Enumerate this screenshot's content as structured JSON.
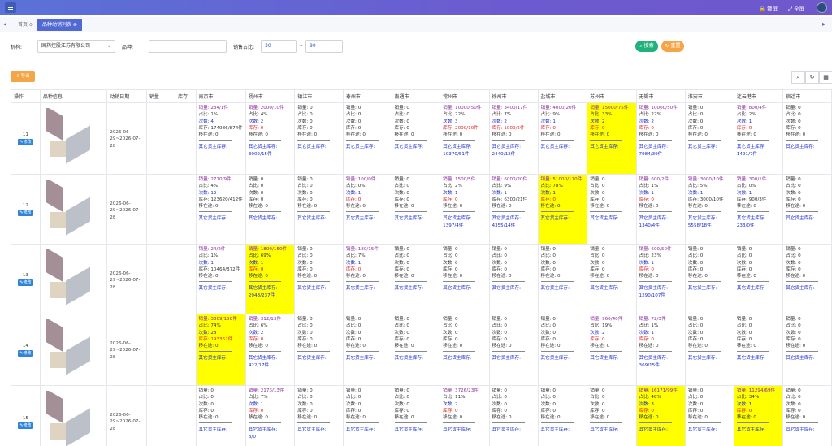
{
  "topbar": {
    "lock_label": "锁屏",
    "fullscreen_label": "全屏"
  },
  "tabs": [
    {
      "label": "首页 ⊙"
    },
    {
      "label": "品种动销列表 ⊗"
    }
  ],
  "filters": {
    "org_label": "机构:",
    "org_value": "国药控股江苏有限公司",
    "variety_label": "品种:",
    "variety_value": "",
    "ratio_label": "销售占比:",
    "ratio_from": "30",
    "ratio_sep": "~",
    "ratio_to": "90",
    "search_label": "搜索",
    "reset_label": "重置"
  },
  "toolbar": {
    "export_label": "导出"
  },
  "columns": [
    "操作",
    "品种信息",
    "动销日期",
    "销量",
    "库存",
    "南京市",
    "扬州市",
    "镇江市",
    "泰州市",
    "南通市",
    "常州市",
    "徐州市",
    "盐城市",
    "苏州市",
    "无锡市",
    "淮安市",
    "连云港市",
    "宿迁市"
  ],
  "labels": {
    "edit": "修改",
    "sales": "销量:",
    "ratio": "占比:",
    "count": "次数:",
    "stock": "库存:",
    "transit": "移在途:",
    "other": "其它货主库存:"
  },
  "rows": [
    {
      "num": "11",
      "period": "2026-06-29~2026-07-28",
      "cities": [
        {
          "s": "234/1件",
          "r": "1%",
          "c": "4",
          "st": "174986/874件",
          "t": "0",
          "o": "",
          "hl": false,
          "stc": "n"
        },
        {
          "s": "2000/10件",
          "r": "4%",
          "c": "2",
          "st": "0",
          "t": "0",
          "o": "3002/15件",
          "hl": false,
          "stc": "r"
        },
        {
          "s": "0",
          "r": "0",
          "c": "0",
          "st": "0",
          "t": "0",
          "o": "",
          "hl": false,
          "stc": "n"
        },
        {
          "s": "0",
          "r": "0",
          "c": "0",
          "st": "0",
          "t": "0",
          "o": "",
          "hl": false,
          "stc": "n"
        },
        {
          "s": "0",
          "r": "0",
          "c": "0",
          "st": "0",
          "t": "0",
          "o": "",
          "hl": false,
          "stc": "n"
        },
        {
          "s": "10000/50件",
          "r": "22%",
          "c": "3",
          "st": "2000/10件",
          "t": "0",
          "o": "10370/51件",
          "hl": false,
          "stc": "r"
        },
        {
          "s": "3400/17件",
          "r": "7%",
          "c": "2",
          "st": "1000/5件",
          "t": "0",
          "o": "2440/12件",
          "hl": false,
          "stc": "r"
        },
        {
          "s": "4000/20件",
          "r": "9%",
          "c": "1",
          "st": "0",
          "t": "0",
          "o": "",
          "hl": false,
          "stc": "r"
        },
        {
          "s": "15000/75件",
          "r": "33%",
          "c": "2",
          "st": "0",
          "t": "0",
          "o": "",
          "hl": true,
          "stc": "r"
        },
        {
          "s": "10000/50件",
          "r": "22%",
          "c": "2",
          "st": "0",
          "t": "0",
          "o": "7984/39件",
          "hl": false,
          "stc": "r"
        },
        {
          "s": "0",
          "r": "0",
          "c": "0",
          "st": "0",
          "t": "0",
          "o": "",
          "hl": false,
          "stc": "n"
        },
        {
          "s": "800/4件",
          "r": "2%",
          "c": "1",
          "st": "0",
          "t": "0",
          "o": "1491/7件",
          "hl": false,
          "stc": "r"
        },
        {
          "s": "0",
          "r": "0",
          "c": "0",
          "st": "0",
          "t": "0",
          "o": "",
          "hl": false,
          "stc": "n"
        }
      ]
    },
    {
      "num": "12",
      "period": "2026-06-29~2026-07-28",
      "cities": [
        {
          "s": "2770/9件",
          "r": "4%",
          "c": "12",
          "st": "123620/412件",
          "t": "0",
          "o": "",
          "hl": false,
          "stc": "n"
        },
        {
          "s": "0",
          "r": "0",
          "c": "0",
          "st": "0",
          "t": "0",
          "o": "",
          "hl": false,
          "stc": "n"
        },
        {
          "s": "0",
          "r": "0",
          "c": "0",
          "st": "0",
          "t": "0",
          "o": "",
          "hl": false,
          "stc": "n"
        },
        {
          "s": "100/0件",
          "r": "0%",
          "c": "1",
          "st": "0",
          "t": "0",
          "o": "",
          "hl": false,
          "stc": "r"
        },
        {
          "s": "0",
          "r": "0",
          "c": "0",
          "st": "0",
          "t": "0",
          "o": "",
          "hl": false,
          "stc": "n"
        },
        {
          "s": "1500/5件",
          "r": "2%",
          "c": "1",
          "st": "0",
          "t": "0",
          "o": "1397/4件",
          "hl": false,
          "stc": "r"
        },
        {
          "s": "6000/20件",
          "r": "9%",
          "c": "1",
          "st": "6300/21件",
          "t": "0",
          "o": "4355/14件",
          "hl": false,
          "stc": "n"
        },
        {
          "s": "51000/170件",
          "r": "78%",
          "c": "1",
          "st": "0",
          "t": "0",
          "o": "",
          "hl": true,
          "stc": "r"
        },
        {
          "s": "0",
          "r": "0",
          "c": "0",
          "st": "0",
          "t": "0",
          "o": "",
          "hl": false,
          "stc": "n"
        },
        {
          "s": "600/2件",
          "r": "1%",
          "c": "1",
          "st": "0",
          "t": "0",
          "o": "1340/4件",
          "hl": false,
          "stc": "r"
        },
        {
          "s": "3000/10件",
          "r": "5%",
          "c": "1",
          "st": "3000/10件",
          "t": "0",
          "o": "5558/18件",
          "hl": false,
          "stc": "n"
        },
        {
          "s": "300/1件",
          "r": "0%",
          "c": "1",
          "st": "900/3件",
          "t": "0",
          "o": "233/0件",
          "hl": false,
          "stc": "n"
        },
        {
          "s": "0",
          "r": "0",
          "c": "0",
          "st": "0",
          "t": "0",
          "o": "",
          "hl": false,
          "stc": "n"
        }
      ]
    },
    {
      "num": "13",
      "period": "2026-06-29~2026-07-28",
      "cities": [
        {
          "s": "24/2件",
          "r": "1%",
          "c": "1",
          "st": "10464/872件",
          "t": "0",
          "o": "",
          "hl": false,
          "stc": "n"
        },
        {
          "s": "1800/150件",
          "r": "69%",
          "c": "1",
          "st": "0",
          "t": "0",
          "o": "2948/237件",
          "hl": true,
          "stc": "r"
        },
        {
          "s": "0",
          "r": "0",
          "c": "0",
          "st": "0",
          "t": "0",
          "o": "",
          "hl": false,
          "stc": "n"
        },
        {
          "s": "180/15件",
          "r": "7%",
          "c": "1",
          "st": "0",
          "t": "0",
          "o": "",
          "hl": false,
          "stc": "r"
        },
        {
          "s": "0",
          "r": "0",
          "c": "0",
          "st": "0",
          "t": "0",
          "o": "",
          "hl": false,
          "stc": "n"
        },
        {
          "s": "0",
          "r": "0",
          "c": "0",
          "st": "0",
          "t": "0",
          "o": "",
          "hl": false,
          "stc": "n"
        },
        {
          "s": "0",
          "r": "0",
          "c": "0",
          "st": "0",
          "t": "0",
          "o": "",
          "hl": false,
          "stc": "n"
        },
        {
          "s": "0",
          "r": "0",
          "c": "0",
          "st": "0",
          "t": "0",
          "o": "",
          "hl": false,
          "stc": "n"
        },
        {
          "s": "0",
          "r": "0",
          "c": "0",
          "st": "0",
          "t": "0",
          "o": "",
          "hl": false,
          "stc": "n"
        },
        {
          "s": "600/50件",
          "r": "23%",
          "c": "1",
          "st": "0",
          "t": "0",
          "o": "1290/107件",
          "hl": false,
          "stc": "r"
        },
        {
          "s": "0",
          "r": "0",
          "c": "0",
          "st": "0",
          "t": "0",
          "o": "",
          "hl": false,
          "stc": "n"
        },
        {
          "s": "0",
          "r": "0",
          "c": "0",
          "st": "0",
          "t": "0",
          "o": "",
          "hl": false,
          "stc": "n"
        },
        {
          "s": "0",
          "r": "0",
          "c": "0",
          "st": "0",
          "t": "0",
          "o": "",
          "hl": false,
          "stc": "n"
        }
      ]
    },
    {
      "num": "14",
      "period": "2026-06-29~2026-07-28",
      "cities": [
        {
          "s": "3809/158件",
          "r": "74%",
          "c": "28",
          "st": "193362件",
          "t": "0",
          "o": "",
          "hl": true,
          "stc": "r"
        },
        {
          "s": "312/13件",
          "r": "6%",
          "c": "2",
          "st": "0",
          "t": "0",
          "o": "422/17件",
          "hl": false,
          "stc": "r"
        },
        {
          "s": "0",
          "r": "0",
          "c": "0",
          "st": "0",
          "t": "0",
          "o": "",
          "hl": false,
          "stc": "n"
        },
        {
          "s": "0",
          "r": "0",
          "c": "0",
          "st": "0",
          "t": "0",
          "o": "",
          "hl": false,
          "stc": "n"
        },
        {
          "s": "0",
          "r": "0",
          "c": "0",
          "st": "0",
          "t": "0",
          "o": "",
          "hl": false,
          "stc": "n"
        },
        {
          "s": "0",
          "r": "0",
          "c": "0",
          "st": "0",
          "t": "0",
          "o": "",
          "hl": false,
          "stc": "n"
        },
        {
          "s": "0",
          "r": "0",
          "c": "0",
          "st": "0",
          "t": "0",
          "o": "",
          "hl": false,
          "stc": "n"
        },
        {
          "s": "0",
          "r": "0",
          "c": "0",
          "st": "0",
          "t": "0",
          "o": "",
          "hl": false,
          "stc": "n"
        },
        {
          "s": "960/40件",
          "r": "19%",
          "c": "2",
          "st": "0",
          "t": "0",
          "o": "",
          "hl": false,
          "stc": "r"
        },
        {
          "s": "72/3件",
          "r": "1%",
          "c": "1",
          "st": "0",
          "t": "0",
          "o": "369/15件",
          "hl": false,
          "stc": "r"
        },
        {
          "s": "0",
          "r": "0",
          "c": "0",
          "st": "0",
          "t": "0",
          "o": "",
          "hl": false,
          "stc": "n"
        },
        {
          "s": "0",
          "r": "0",
          "c": "0",
          "st": "0",
          "t": "0",
          "o": "",
          "hl": false,
          "stc": "n"
        },
        {
          "s": "0",
          "r": "0",
          "c": "0",
          "st": "0",
          "t": "0",
          "o": "",
          "hl": false,
          "stc": "n"
        }
      ]
    },
    {
      "num": "15",
      "period": "2026-06-29~2026-07-28",
      "cities": [
        {
          "s": "0",
          "r": "0",
          "c": "0",
          "st": "0",
          "t": "0",
          "o": "",
          "hl": false,
          "stc": "n"
        },
        {
          "s": "2173/13件",
          "r": "7%",
          "c": "1",
          "st": "0",
          "t": "0",
          "o": "3/0",
          "hl": false,
          "stc": "r"
        },
        {
          "s": "0",
          "r": "0",
          "c": "0",
          "st": "0",
          "t": "0",
          "o": "",
          "hl": false,
          "stc": "n"
        },
        {
          "s": "0",
          "r": "0",
          "c": "0",
          "st": "0",
          "t": "0",
          "o": "",
          "hl": false,
          "stc": "n"
        },
        {
          "s": "0",
          "r": "0",
          "c": "0",
          "st": "0",
          "t": "0",
          "o": "",
          "hl": false,
          "stc": "n"
        },
        {
          "s": "3726/23件",
          "r": "11%",
          "c": "2",
          "st": "0",
          "t": "0",
          "o": "",
          "hl": false,
          "stc": "r"
        },
        {
          "s": "0",
          "r": "0",
          "c": "0",
          "st": "0",
          "t": "0",
          "o": "",
          "hl": false,
          "stc": "n"
        },
        {
          "s": "0",
          "r": "0",
          "c": "0",
          "st": "0",
          "t": "0",
          "o": "",
          "hl": false,
          "stc": "n"
        },
        {
          "s": "0",
          "r": "0",
          "c": "0",
          "st": "0",
          "t": "0",
          "o": "",
          "hl": false,
          "stc": "n"
        },
        {
          "s": "16171/99件",
          "r": "48%",
          "c": "3",
          "st": "0",
          "t": "0",
          "o": "",
          "hl": true,
          "stc": "r"
        },
        {
          "s": "0",
          "r": "0",
          "c": "0",
          "st": "0",
          "t": "0",
          "o": "",
          "hl": false,
          "stc": "n"
        },
        {
          "s": "11294/69件",
          "r": "34%",
          "c": "1",
          "st": "0",
          "t": "0",
          "o": "",
          "hl": true,
          "stc": "r"
        },
        {
          "s": "0",
          "r": "0",
          "c": "0",
          "st": "0",
          "t": "0",
          "o": "",
          "hl": false,
          "stc": "n"
        }
      ]
    }
  ]
}
